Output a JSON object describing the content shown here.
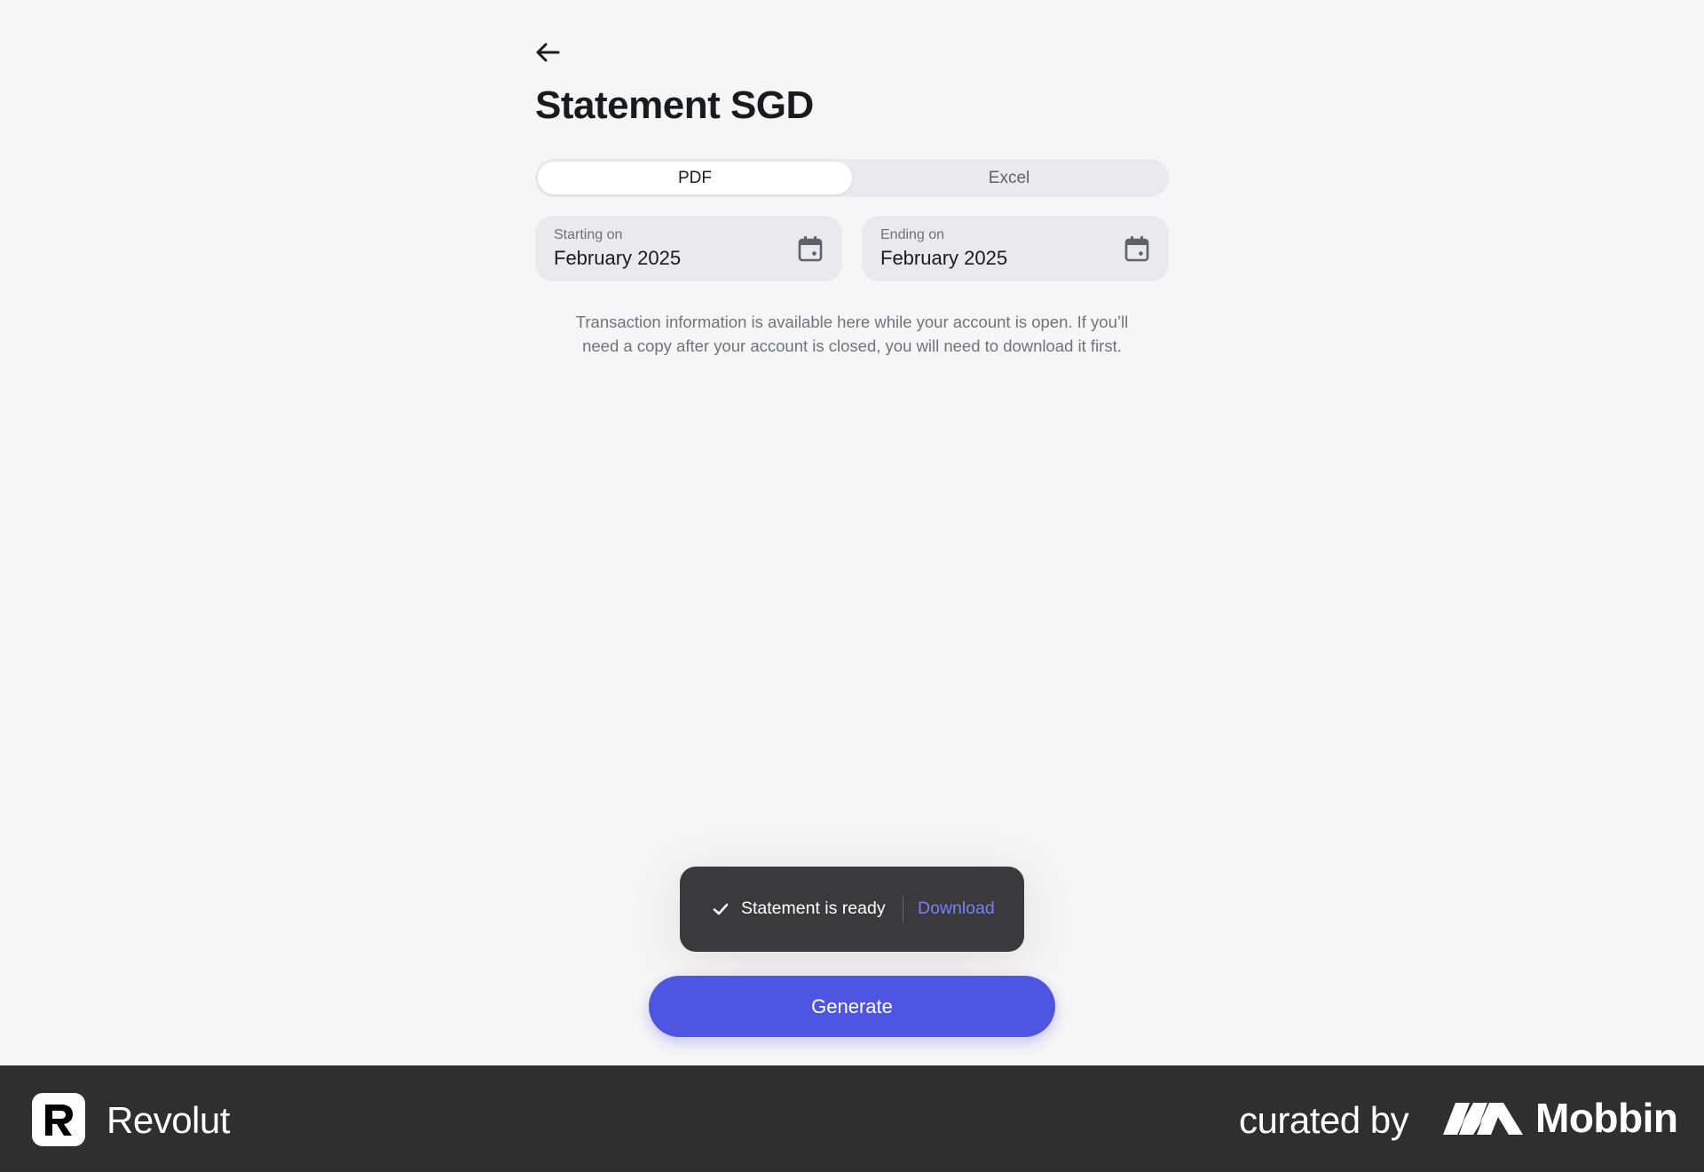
{
  "page": {
    "title": "Statement SGD",
    "back_icon": "arrow-left-icon"
  },
  "format_tabs": {
    "items": [
      {
        "label": "PDF",
        "active": true
      },
      {
        "label": "Excel",
        "active": false
      }
    ]
  },
  "dates": {
    "start": {
      "label": "Starting on",
      "value": "February 2025",
      "icon": "calendar-icon"
    },
    "end": {
      "label": "Ending on",
      "value": "February 2025",
      "icon": "calendar-icon"
    }
  },
  "info_text": {
    "line1": "Transaction information is available here while your account is open. If you’ll",
    "line2": "need a copy after your account is closed, you will need to download it first."
  },
  "toast": {
    "icon": "check-icon",
    "message": "Statement is ready",
    "action": "Download"
  },
  "actions": {
    "generate_label": "Generate"
  },
  "footer": {
    "brand": "Revolut",
    "curated_by": "curated by",
    "curator": "Mobbin"
  },
  "colors": {
    "background": "#f6f6f6",
    "primary": "#4f55e3",
    "toast_bg": "#3a3a3c",
    "toast_link": "#7b7fff",
    "footer_bg": "#2f2f2f"
  }
}
